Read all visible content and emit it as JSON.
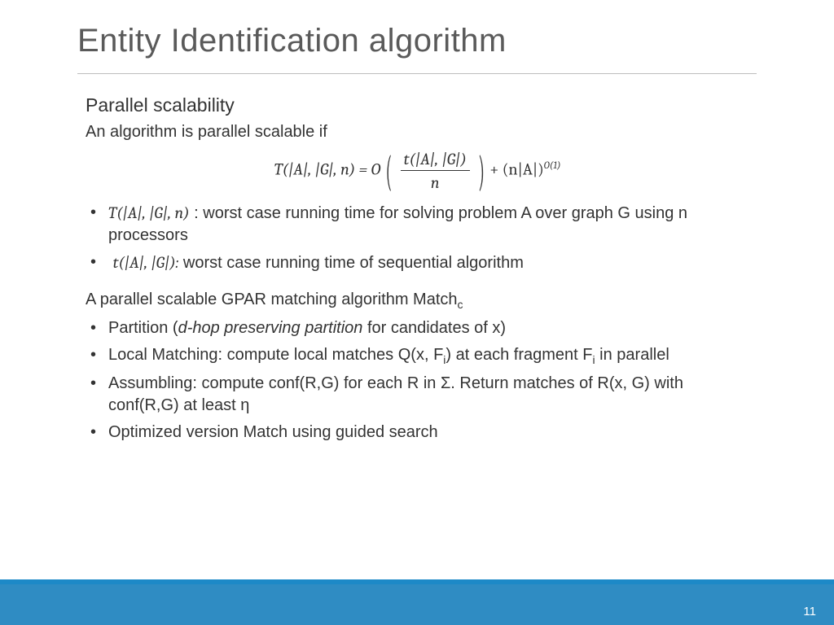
{
  "title": "Entity Identification algorithm",
  "subhead": "Parallel scalability",
  "intro": "An algorithm is parallel scalable if",
  "equation": {
    "lhs": "T(|A|, |G|, n) = O",
    "num": "t(|A|, |G|)",
    "den": "n",
    "tail_base": "+ (n|A|)",
    "tail_exp": "O(1)"
  },
  "bullets_a": [
    {
      "math": "T(|A|, |G|, n)",
      "after": " : worst case running time for solving problem A over graph G using n processors"
    },
    {
      "math": "t(|A|, |G|):",
      "after": " worst case running time of sequential algorithm"
    }
  ],
  "second_head_pre": "A parallel scalable GPAR matching algorithm Match",
  "second_head_sub": "c",
  "bullets_b": {
    "b1_pre": "Partition (",
    "b1_em": "d-hop preserving partition",
    "b1_post": " for candidates of x)",
    "b2_pre": "Local Matching: compute local matches Q(x, F",
    "b2_sub1": "i",
    "b2_mid": ") at each fragment F",
    "b2_sub2": "i",
    "b2_post": "  in parallel",
    "b3": "Assumbling: compute conf(R,G) for each R in Σ. Return matches of R(x, G) with conf(R,G) at least η",
    "b4": "Optimized version Match using guided search"
  },
  "page_number": "11"
}
